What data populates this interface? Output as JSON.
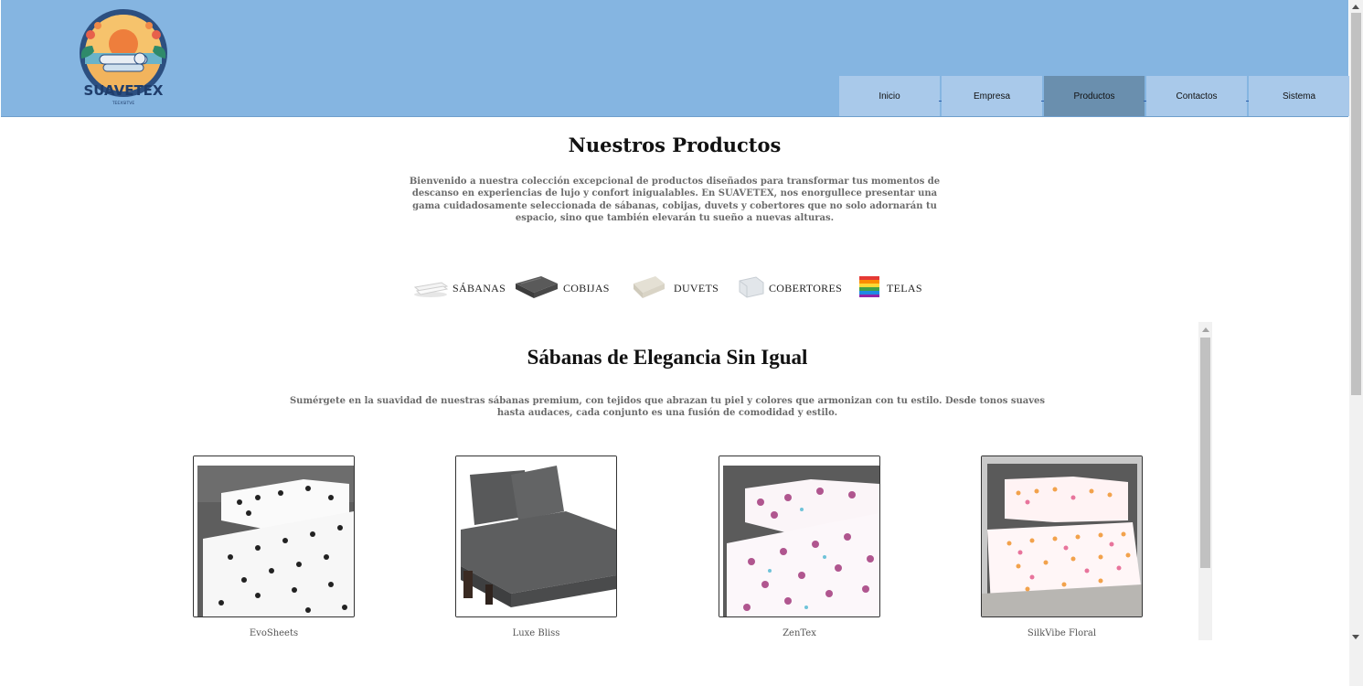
{
  "brand": {
    "name": "SUAVETEX",
    "tagline": "TEEXSITVE"
  },
  "nav": {
    "items": [
      {
        "label": "Inicio"
      },
      {
        "label": "Empresa"
      },
      {
        "label": "Productos",
        "active": true
      },
      {
        "label": "Contactos"
      },
      {
        "label": "Sistema"
      }
    ]
  },
  "main": {
    "title": "Nuestros Productos",
    "intro": "Bienvenido a nuestra colección excepcional de productos diseñados para transformar tus momentos de descanso en experiencias de lujo y confort inigualables. En SUAVETEX, nos enorgullece presentar una gama cuidadosamente seleccionada de sábanas, cobijas, duvets y cobertores que no solo adornarán tu espacio, sino que también elevarán tu sueño a nuevas alturas."
  },
  "categories": [
    {
      "label": "SÁBANAS",
      "icon": "sheets-icon"
    },
    {
      "label": "COBIJAS",
      "icon": "blanket-icon"
    },
    {
      "label": "DUVETS",
      "icon": "duvet-icon"
    },
    {
      "label": "COBERTORES",
      "icon": "comforter-icon"
    },
    {
      "label": "TELAS",
      "icon": "fabric-icon"
    }
  ],
  "section": {
    "title": "Sábanas de Elegancia Sin Igual",
    "description": "Sumérgete en la suavidad de nuestras sábanas premium, con tejidos que abrazan tu piel y colores que armonizan con tu estilo. Desde tonos suaves hasta audaces, cada conjunto es una fusión de comodidad y estilo."
  },
  "products": [
    {
      "name": "EvoSheets"
    },
    {
      "name": "Luxe Bliss"
    },
    {
      "name": "ZenTex"
    },
    {
      "name": "SilkVibe Floral"
    }
  ],
  "colors": {
    "header_bg": "#85b5e1",
    "nav_bg": "#a9c9ea",
    "nav_active_bg": "#6a8fae"
  }
}
